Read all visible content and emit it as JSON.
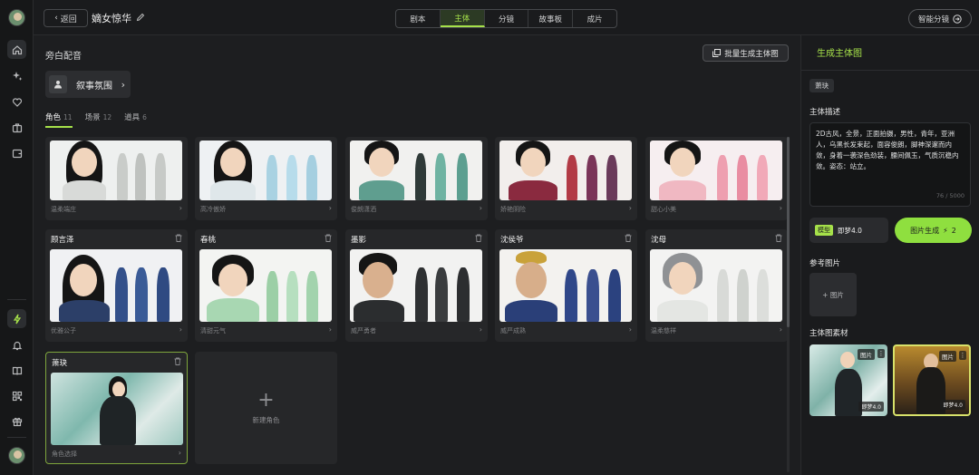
{
  "header": {
    "back_label": "返回",
    "project_title": "嫡女惊华",
    "tabs": [
      {
        "label": "剧本",
        "active": false
      },
      {
        "label": "主体",
        "active": true
      },
      {
        "label": "分镜",
        "active": false
      },
      {
        "label": "故事板",
        "active": false
      },
      {
        "label": "成片",
        "active": false
      }
    ],
    "smart_storyboard_label": "智能分镜"
  },
  "main": {
    "voice_label": "旁白配音",
    "batch_button_label": "批量生成主体图",
    "ambience_label": "叙事氛围",
    "subtabs": [
      {
        "label": "角色",
        "count": "11",
        "active": true
      },
      {
        "label": "场景",
        "count": "12",
        "active": false
      },
      {
        "label": "道具",
        "count": "6",
        "active": false
      }
    ],
    "cards_row1": [
      {
        "footer": "温柔端庄"
      },
      {
        "footer": "高冷傲娇"
      },
      {
        "footer": "俊朗潇洒"
      },
      {
        "footer": "娇艳阴险"
      },
      {
        "footer": "甜心小美"
      }
    ],
    "cards_row2": [
      {
        "name": "顾言泽",
        "footer": "优雅公子"
      },
      {
        "name": "春桃",
        "footer": "清甜元气"
      },
      {
        "name": "墨影",
        "footer": "威严勇者"
      },
      {
        "name": "沈侯爷",
        "footer": "威严成熟"
      },
      {
        "name": "沈母",
        "footer": "温柔慈祥"
      }
    ],
    "card_selected": {
      "name": "萧玦",
      "footer": "角色选择"
    },
    "new_card_label": "新建角色",
    "new_card_plus": "+"
  },
  "panel": {
    "title": "生成主体图",
    "chip": "萧玦",
    "desc_label": "主体描述",
    "description": "2D古风，全景，正面拍摄，男性，青年，亚洲人，乌黑长发束起，面容俊朗，脚神深邃而内敛，身着一袭深色劲装，腰间佩玉，气质沉稳内敛。姿态：站立。",
    "char_count": "76 / 5000",
    "model_tag": "模型",
    "model_name": "即梦4.0",
    "generate_label": "图片生成",
    "generate_cost": "2",
    "ref_label": "参考图片",
    "ref_add": "+ 图片",
    "material_label": "主体图素材",
    "materials": [
      {
        "tag": "图片",
        "model": "即梦4.0"
      },
      {
        "tag": "图片",
        "model": "即梦4.0"
      }
    ]
  },
  "colors": {
    "accent": "#a6e14a",
    "background": "#1d1e20",
    "card": "#262729"
  },
  "icons": [
    "home-icon",
    "sparkles-icon",
    "heart-icon",
    "briefcase-icon",
    "wallet-icon",
    "bolt-icon",
    "bell-icon",
    "book-icon",
    "qr-icon",
    "gift-icon",
    "pencil-icon",
    "chevron-right-icon",
    "trash-icon",
    "images-icon",
    "user-icon"
  ]
}
